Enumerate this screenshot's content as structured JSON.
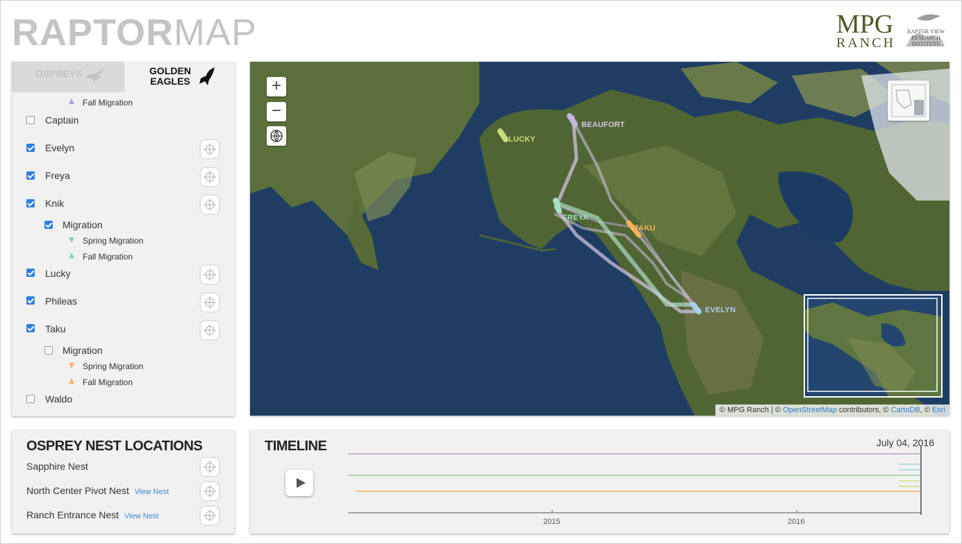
{
  "header": {
    "title_bold": "RAPTOR",
    "title_light": "MAP",
    "brand_main": "MPG",
    "brand_sub": "RANCH",
    "partner": "RAPTOR VIEW RESEARCH INSTITUTE"
  },
  "tabs": [
    {
      "label": "OSPREYS",
      "active": false,
      "icon": "osprey-icon"
    },
    {
      "label": "GOLDEN EAGLES",
      "active": true,
      "icon": "eagle-icon"
    }
  ],
  "birds_list": {
    "top_sub": {
      "label": "Fall Migration",
      "color": "#b89fd0"
    },
    "items": [
      {
        "name": "Captain",
        "checked": false
      },
      {
        "name": "Evelyn",
        "checked": true
      },
      {
        "name": "Freya",
        "checked": true
      },
      {
        "name": "Knik",
        "checked": true,
        "migration": {
          "label": "Migration",
          "checked": true,
          "spring": "Spring Migration",
          "fall": "Fall Migration",
          "spring_color": "#8fd19e",
          "fall_color": "#8fd19e"
        }
      },
      {
        "name": "Lucky",
        "checked": true
      },
      {
        "name": "Phileas",
        "checked": true
      },
      {
        "name": "Taku",
        "checked": true,
        "migration": {
          "label": "Migration",
          "checked": false,
          "spring": "Spring Migration",
          "fall": "Fall Migration",
          "spring_color": "#f6b35a",
          "fall_color": "#f6b35a"
        }
      },
      {
        "name": "Waldo",
        "checked": false
      }
    ]
  },
  "map": {
    "zoom_in": "+",
    "zoom_out": "−",
    "globe_icon": "globe-icon",
    "labels": [
      {
        "text": "BEAUFORT",
        "color": "#d9c6ea"
      },
      {
        "text": "LUCKY",
        "color": "#c8de7a"
      },
      {
        "text": "FREYA",
        "color": "#a8e0c4"
      },
      {
        "text": "TAKU",
        "color": "#f6b35a"
      },
      {
        "text": "EVELYN",
        "color": "#a9d0ec"
      }
    ],
    "attribution": {
      "prefix": "© MPG Ranch | © ",
      "osm": "OpenStreetMap",
      "mid": " contributors, © ",
      "carto": "CartoDB",
      "sep": ", © ",
      "esri": "Esri"
    }
  },
  "nests": {
    "title": "OSPREY NEST LOCATIONS",
    "items": [
      {
        "name": "Sapphire Nest",
        "link": ""
      },
      {
        "name": "North Center Pivot Nest",
        "link": "View Nest"
      },
      {
        "name": "Ranch Entrance Nest",
        "link": "View Nest"
      }
    ]
  },
  "timeline": {
    "title": "TIMELINE",
    "current_date": "July 04, 2016",
    "ticks": [
      "2015",
      "2016"
    ],
    "track_colors": [
      "#b59fd6",
      "#9fd8d8",
      "#8fcf8f",
      "#c8de7a",
      "#f6b35a"
    ]
  }
}
